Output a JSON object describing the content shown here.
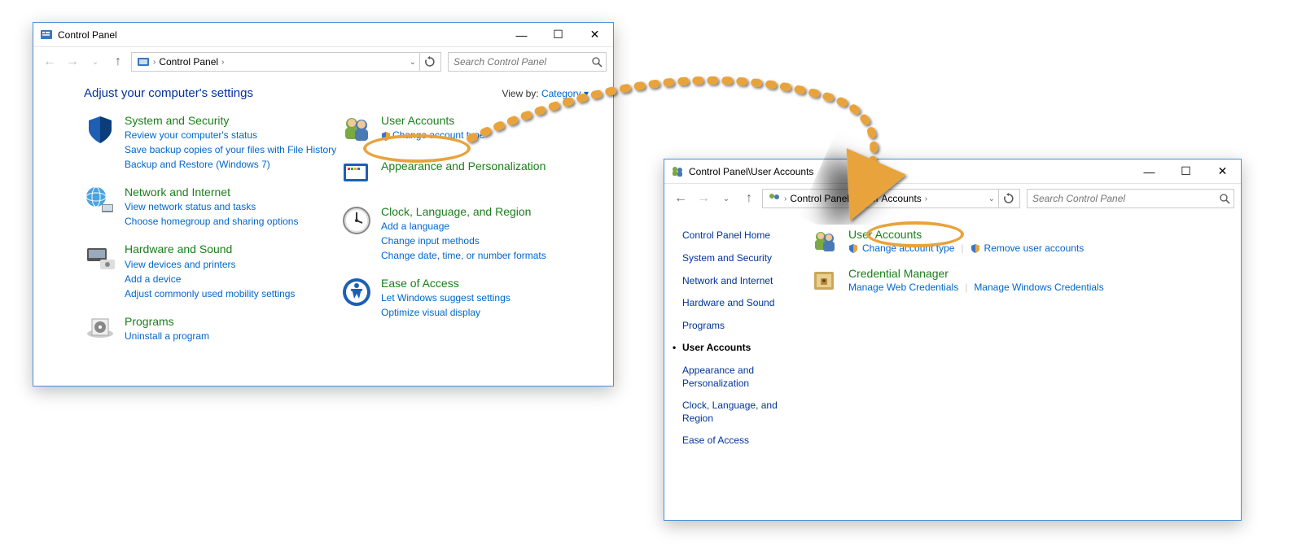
{
  "window1": {
    "title": "Control Panel",
    "breadcrumb": [
      "Control Panel"
    ],
    "search_placeholder": "Search Control Panel",
    "heading": "Adjust your computer's settings",
    "viewby_label": "View by:",
    "viewby_value": "Category",
    "categories_left": [
      {
        "title": "System and Security",
        "links": [
          "Review your computer's status",
          "Save backup copies of your files with File History",
          "Backup and Restore (Windows 7)"
        ]
      },
      {
        "title": "Network and Internet",
        "links": [
          "View network status and tasks",
          "Choose homegroup and sharing options"
        ]
      },
      {
        "title": "Hardware and Sound",
        "links": [
          "View devices and printers",
          "Add a device",
          "Adjust commonly used mobility settings"
        ]
      },
      {
        "title": "Programs",
        "links": [
          "Uninstall a program"
        ]
      }
    ],
    "categories_right": [
      {
        "title": "User Accounts",
        "links": [
          "Change account type"
        ],
        "shield": true
      },
      {
        "title": "Appearance and Personalization",
        "links": []
      },
      {
        "title": "Clock, Language, and Region",
        "links": [
          "Add a language",
          "Change input methods",
          "Change date, time, or number formats"
        ]
      },
      {
        "title": "Ease of Access",
        "links": [
          "Let Windows suggest settings",
          "Optimize visual display"
        ]
      }
    ]
  },
  "window2": {
    "title": "Control Panel\\User Accounts",
    "breadcrumb": [
      "Control Panel",
      "User Accounts"
    ],
    "search_placeholder": "Search Control Panel",
    "sidebar_title": "Control Panel Home",
    "sidebar_items": [
      "System and Security",
      "Network and Internet",
      "Hardware and Sound",
      "Programs",
      "User Accounts",
      "Appearance and Personalization",
      "Clock, Language, and Region",
      "Ease of Access"
    ],
    "sidebar_active_index": 4,
    "sections": [
      {
        "title": "User Accounts",
        "links": [
          "Change account type",
          "Remove user accounts"
        ],
        "shields": [
          true,
          true
        ]
      },
      {
        "title": "Credential Manager",
        "links": [
          "Manage Web Credentials",
          "Manage Windows Credentials"
        ],
        "shields": [
          false,
          false
        ]
      }
    ]
  }
}
